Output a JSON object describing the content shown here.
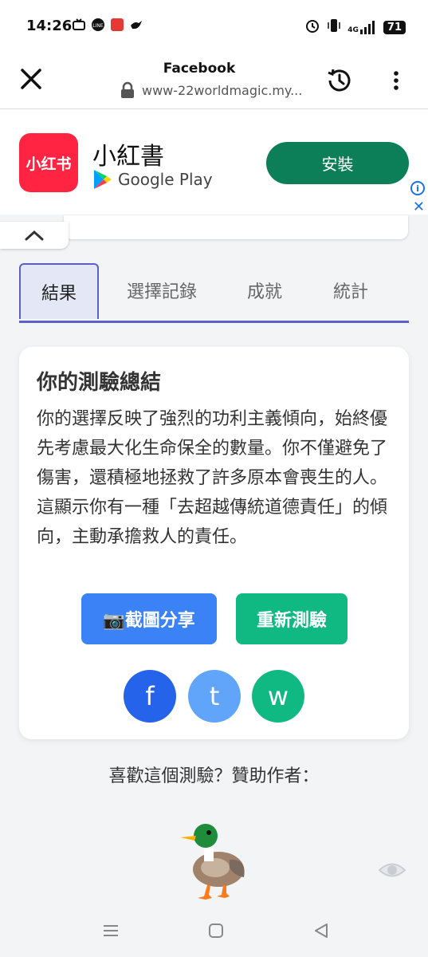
{
  "status": {
    "time": "14:26",
    "app_icons": [
      "tv-icon",
      "line-icon",
      "red-app-icon",
      "bird-icon"
    ],
    "net": "4G",
    "battery": "71"
  },
  "browser": {
    "title": "Facebook",
    "url": "www-22worldmagic.my..."
  },
  "ad": {
    "logo_text": "小红书",
    "app_name": "小紅書",
    "store": "Google Play",
    "install_label": "安裝",
    "info_glyph": "i",
    "close_glyph": "✕"
  },
  "tabs": [
    "結果",
    "選擇記錄",
    "成就",
    "統計"
  ],
  "summary": {
    "title": "你的測驗總結",
    "body": "你的選擇反映了強烈的功利主義傾向，始終優先考慮最大化生命保全的數量。你不僅避免了傷害，還積極地拯救了許多原本會喪生的人。這顯示你有一種「去超越傳統道德責任」的傾向，主動承擔救人的責任。",
    "share_label": "📷截圖分享",
    "retry_label": "重新測驗"
  },
  "social": {
    "facebook": "f",
    "twitter": "t",
    "whatsapp": "w"
  },
  "sponsor_text": "喜歡這個測驗？贊助作者：",
  "colors": {
    "accent": "#5b5fc7",
    "share": "#3b82f6",
    "retry": "#10b981",
    "install": "#0c7f59"
  }
}
